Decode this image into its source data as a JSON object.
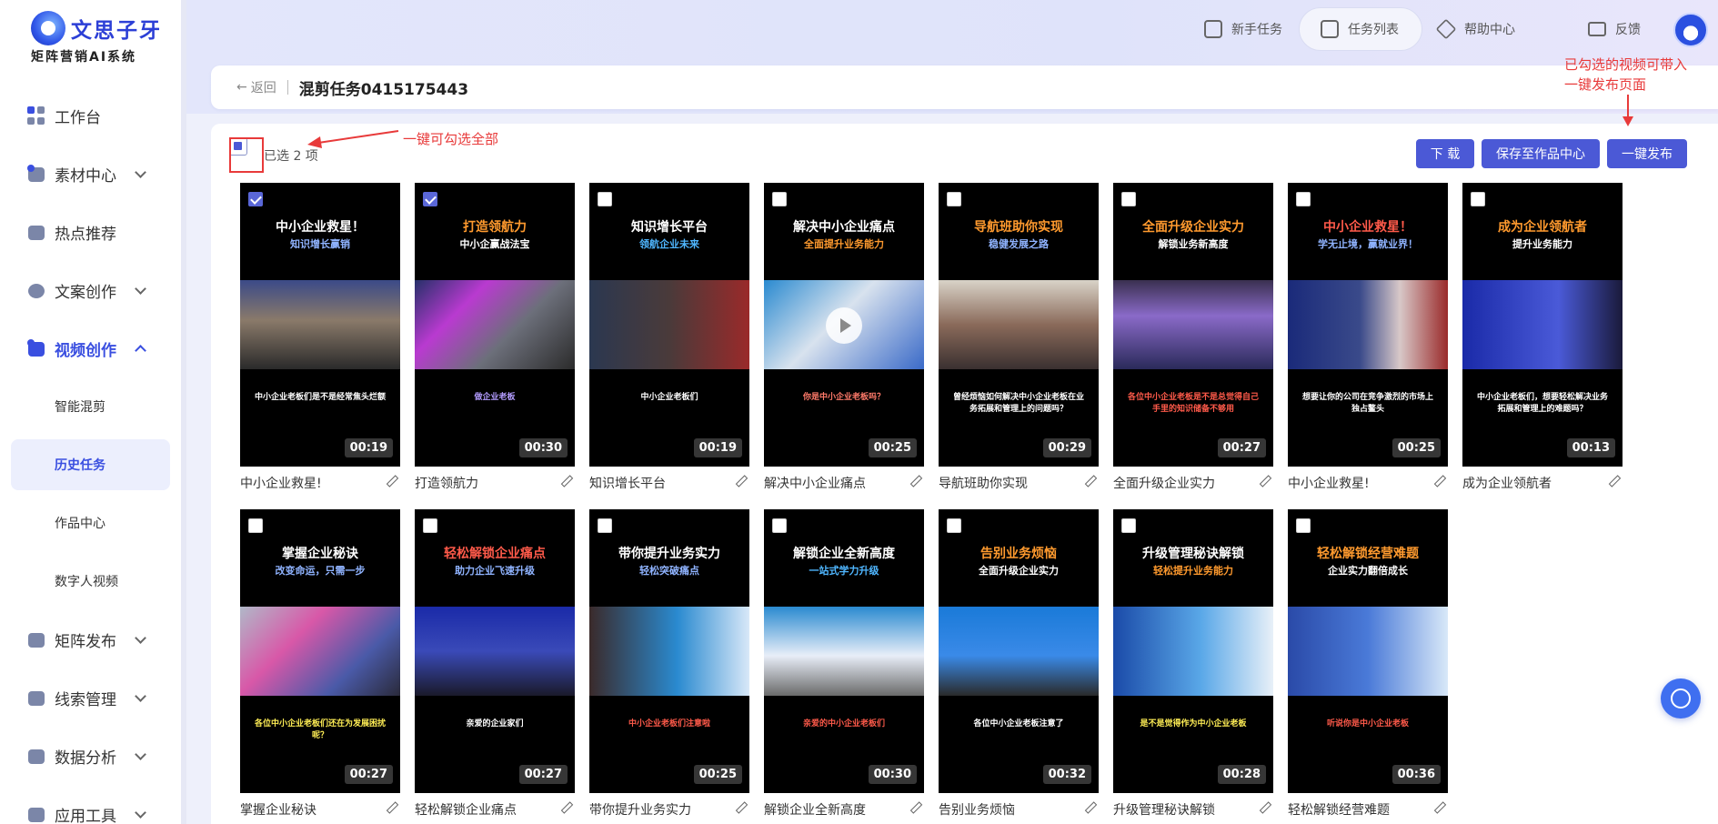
{
  "brand": {
    "name": "文思子牙",
    "tagline": "矩阵营销AI系统"
  },
  "topbar": {
    "items": [
      {
        "label": "新手任务"
      },
      {
        "label": "任务列表"
      },
      {
        "label": "帮助中心"
      },
      {
        "label": "反馈"
      }
    ]
  },
  "sidebar": {
    "items": [
      {
        "label": "工作台"
      },
      {
        "label": "素材中心"
      },
      {
        "label": "热点推荐"
      },
      {
        "label": "文案创作"
      },
      {
        "label": "视频创作"
      },
      {
        "label": "矩阵发布"
      },
      {
        "label": "线索管理"
      },
      {
        "label": "数据分析"
      },
      {
        "label": "应用工具"
      }
    ],
    "video_sub": [
      {
        "label": "智能混剪"
      },
      {
        "label": "历史任务"
      },
      {
        "label": "作品中心"
      },
      {
        "label": "数字人视频"
      }
    ]
  },
  "header": {
    "back_label": "返回",
    "title": "混剪任务0415175443"
  },
  "toolbar": {
    "selected_text": "已选 2 项",
    "download_label": "下 载",
    "save_label": "保存至作品中心",
    "publish_label": "一键发布"
  },
  "annotations": {
    "select_all_note": "一键可勾选全部",
    "publish_note_line1": "已勾选的视频可带入",
    "publish_note_line2": "一键发布页面"
  },
  "videos": [
    {
      "title": "中小企业救星！",
      "subtitle": "知识增长赢销",
      "caption": "中小企业老板们是不是经常焦头烂额",
      "duration": "00:19",
      "name": "中小企业救星!",
      "checked": true,
      "t1color": "#ffffff",
      "t2color": "#8fb3ff",
      "capcolor": "#ffffff"
    },
    {
      "title": "打造领航力",
      "subtitle": "中小企赢战法宝",
      "caption": "做企业老板",
      "duration": "00:30",
      "name": "打造领航力",
      "checked": true,
      "t1color": "#ff9a2e",
      "t2color": "#ffffff",
      "capcolor": "#b39cff"
    },
    {
      "title": "知识增长平台",
      "subtitle": "领航企业未来",
      "caption": "中小企业老板们",
      "duration": "00:19",
      "name": "知识增长平台",
      "checked": false,
      "t1color": "#ffffff",
      "t2color": "#4fb6ff",
      "capcolor": "#ffffff"
    },
    {
      "title": "解决中小企业痛点",
      "subtitle": "全面提升业务能力",
      "caption": "你是中小企业老板吗？",
      "duration": "00:25",
      "name": "解决中小企业痛点",
      "checked": false,
      "t1color": "#ffffff",
      "t2color": "#ff9a2e",
      "capcolor": "#ff7a6a"
    },
    {
      "title": "导航班助你实现",
      "subtitle": "稳健发展之路",
      "caption": "曾经烦恼如何解决中小企业老板在业务拓展和管理上的问题吗？",
      "duration": "00:29",
      "name": "导航班助你实现",
      "checked": false,
      "t1color": "#ff9a2e",
      "t2color": "#8fb3ff",
      "capcolor": "#ffffff"
    },
    {
      "title": "全面升级企业实力",
      "subtitle": "解锁业务新高度",
      "caption": "各位中小企业老板是不是总觉得自己手里的知识储备不够用",
      "duration": "00:27",
      "name": "全面升级企业实力",
      "checked": false,
      "t1color": "#ff9a2e",
      "t2color": "#ffffff",
      "capcolor": "#ff5a4a"
    },
    {
      "title": "中小企业救星！",
      "subtitle": "学无止境，赢就业界！",
      "caption": "想要让你的公司在竞争激烈的市场上独占鳌头",
      "duration": "00:25",
      "name": "中小企业救星!",
      "checked": false,
      "t1color": "#ff5a4a",
      "t2color": "#8fb3ff",
      "capcolor": "#ffffff"
    },
    {
      "title": "成为企业领航者",
      "subtitle": "提升业务能力",
      "caption": "中小企业老板们，想要轻松解决业务拓展和管理上的难题吗？",
      "duration": "00:13",
      "name": "成为企业领航者",
      "checked": false,
      "t1color": "#ff9a2e",
      "t2color": "#ffffff",
      "capcolor": "#ffffff"
    },
    {
      "title": "掌握企业秘诀",
      "subtitle": "改变命运，只需一步",
      "caption": "各位中小企业老板们还在为发展困扰呢？",
      "duration": "00:27",
      "name": "掌握企业秘诀",
      "checked": false,
      "t1color": "#ffffff",
      "t2color": "#8fb3ff",
      "capcolor": "#ffee55"
    },
    {
      "title": "轻松解锁企业痛点",
      "subtitle": "助力企业飞速升级",
      "caption": "亲爱的企业家们",
      "duration": "00:27",
      "name": "轻松解锁企业痛点",
      "checked": false,
      "t1color": "#ff5a4a",
      "t2color": "#8fb3ff",
      "capcolor": "#ffffff"
    },
    {
      "title": "带你提升业务实力",
      "subtitle": "轻松突破痛点",
      "caption": "中小企业老板们注意啦",
      "duration": "00:25",
      "name": "带你提升业务实力",
      "checked": false,
      "t1color": "#ffffff",
      "t2color": "#8fb3ff",
      "capcolor": "#ff5a4a"
    },
    {
      "title": "解锁企业全新高度",
      "subtitle": "一站式学力升级",
      "caption": "亲爱的中小企业老板们",
      "duration": "00:30",
      "name": "解锁企业全新高度",
      "checked": false,
      "t1color": "#ffffff",
      "t2color": "#4fb6ff",
      "capcolor": "#ff5a4a"
    },
    {
      "title": "告别业务烦恼",
      "subtitle": "全面升级企业实力",
      "caption": "各位中小企业老板注意了",
      "duration": "00:32",
      "name": "告别业务烦恼",
      "checked": false,
      "t1color": "#ff9a2e",
      "t2color": "#ffffff",
      "capcolor": "#ffffff"
    },
    {
      "title": "升级管理秘诀解锁",
      "subtitle": "轻松提升业务能力",
      "caption": "是不是觉得作为中小企业老板",
      "duration": "00:28",
      "name": "升级管理秘诀解锁",
      "checked": false,
      "t1color": "#ffffff",
      "t2color": "#ff9a2e",
      "capcolor": "#ffee55"
    },
    {
      "title": "轻松解锁经营难题",
      "subtitle": "企业实力翻倍成长",
      "caption": "听说你是中小企业老板",
      "duration": "00:36",
      "name": "轻松解锁经营难题",
      "checked": false,
      "t1color": "#ff9a2e",
      "t2color": "#ffffff",
      "capcolor": "#ff5a4a"
    }
  ]
}
